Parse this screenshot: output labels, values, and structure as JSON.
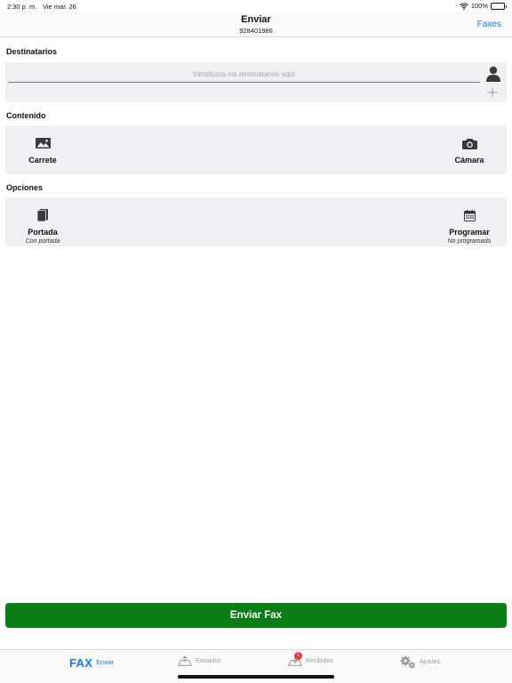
{
  "status_bar": {
    "time": "2:30 p. m.",
    "date": "Vie mar. 26",
    "battery": "100%"
  },
  "nav": {
    "title": "Enviar",
    "subtitle": "928401986",
    "action": "Faxes"
  },
  "recipients": {
    "label": "Destinatarios",
    "placeholder": "Introduzca los destinatarios aquí",
    "value": ""
  },
  "content": {
    "label": "Contenido",
    "items": [
      {
        "label": "Carrete",
        "icon": "photo-icon"
      },
      {
        "label": "Cámara",
        "icon": "camera-icon"
      }
    ]
  },
  "options": {
    "label": "Opciones",
    "items": [
      {
        "label": "Portada",
        "sublabel": "Con portada",
        "icon": "cover-page-icon"
      },
      {
        "label": "Programar",
        "sublabel": "No programado",
        "icon": "calendar-icon"
      }
    ]
  },
  "send_button": {
    "label": "Enviar Fax"
  },
  "tabs": [
    {
      "logo": "FAX",
      "label": "Enviar",
      "active": true
    },
    {
      "label": "Enviados",
      "icon": "outbox-icon"
    },
    {
      "label": "Recibidos",
      "icon": "inbox-icon",
      "badge": "1"
    },
    {
      "label": "Ajustes",
      "icon": "gears-icon"
    }
  ],
  "colors": {
    "accent": "#1a7ae6",
    "send_button": "#0a7d14",
    "panel_background": "#f0f0f4",
    "badge": "#e53935"
  }
}
